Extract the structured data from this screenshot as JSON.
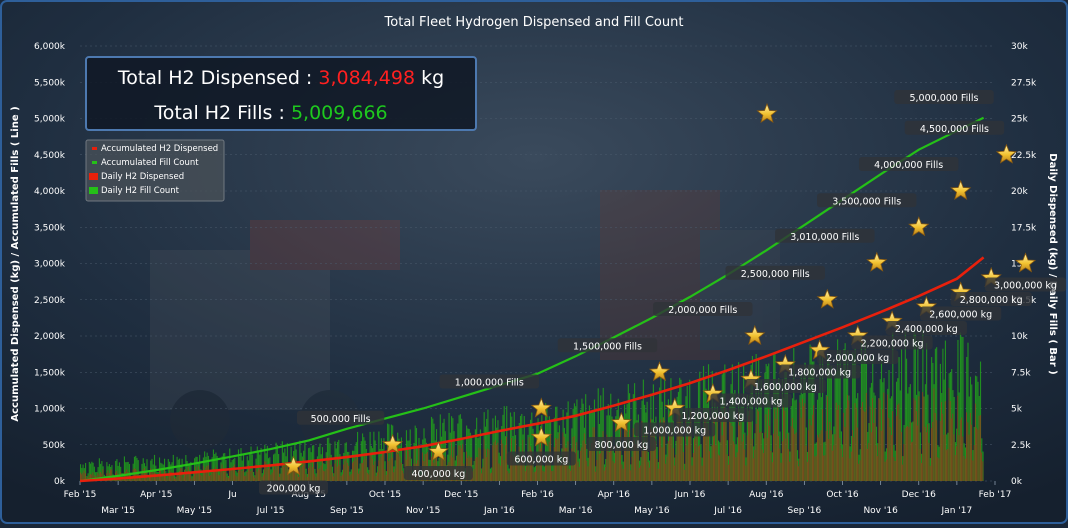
{
  "chart_data": {
    "type": "line+bar",
    "title": "Total Fleet Hydrogen Dispensed and Fill Count",
    "ylabel_left": "Accumulated Dispensed (kg) / Accumulated Fills ( Line )",
    "ylabel_right": "Daily Dispensed (kg) / Daily Fills ( Bar )",
    "ylim_left": [
      0,
      6000
    ],
    "ylim_right": [
      0,
      30000
    ],
    "y_ticks_left": [
      "0k",
      "500k",
      "1,000k",
      "1,500k",
      "2,000k",
      "2,500k",
      "3,000k",
      "3,500k",
      "4,000k",
      "4,500k",
      "5,000k",
      "5,500k",
      "6,000k"
    ],
    "y_ticks_right": [
      "0k",
      "2.5k",
      "5k",
      "7.5k",
      "10k",
      "12.5k",
      "15k",
      "17.5k",
      "20k",
      "22.5k",
      "25k",
      "27.5k",
      "30k"
    ],
    "x_ticks": [
      "Feb '15",
      "Mar '15",
      "Apr '15",
      "May '15",
      "Jun '15",
      "Jul '15",
      "Aug '15",
      "Sep '15",
      "Oct '15",
      "Nov '15",
      "Dec '15",
      "Jan '16",
      "Feb '16",
      "Mar '16",
      "Apr '16",
      "May '16",
      "Jun '16",
      "Jul '16",
      "Aug '16",
      "Sep '16",
      "Oct '16",
      "Nov '16",
      "Dec '16",
      "Jan '17",
      "Feb '17"
    ],
    "x_ticks_display": [
      "Feb '15",
      "Mar '15",
      "Apr '15",
      "May '15",
      "Ju",
      "Jul '15",
      "Aug '15",
      "Sep '15",
      "Oct '15",
      "Nov '15",
      "Dec '15",
      "Jan '16",
      "Feb '16",
      "Mar '16",
      "Apr '16",
      "May '16",
      "Jun '16",
      "Jul '16",
      "Aug '16",
      "Sep '16",
      "Oct '16",
      "Nov '16",
      "Dec '16",
      "Jan '17",
      "Feb '17"
    ],
    "legend": [
      "Accumulated H2 Dispensed",
      "Accumulated Fill Count",
      "Daily H2 Dispensed",
      "Daily H2 Fill Count"
    ],
    "legend_position": "top-left",
    "series_colors": {
      "dispensed": "#e8200c",
      "fills": "#25c018"
    },
    "accumulated_dispensed": {
      "x": [
        0,
        1,
        2,
        3,
        4,
        5,
        6,
        7,
        8,
        9,
        10,
        11,
        12,
        13,
        14,
        15,
        16,
        17,
        18,
        19,
        20,
        21,
        22,
        23,
        23.7
      ],
      "y": [
        0,
        35,
        75,
        120,
        165,
        215,
        270,
        330,
        400,
        480,
        580,
        690,
        790,
        900,
        1040,
        1190,
        1350,
        1530,
        1720,
        1920,
        2120,
        2330,
        2550,
        2790,
        3084
      ]
    },
    "accumulated_fills": {
      "x": [
        0,
        1,
        2,
        3,
        4,
        5,
        6,
        7,
        8,
        9,
        10,
        11,
        12,
        13,
        14,
        15,
        16,
        17,
        18,
        19,
        20,
        21,
        22,
        23,
        23.7
      ],
      "y": [
        0,
        70,
        150,
        240,
        340,
        440,
        560,
        720,
        860,
        1000,
        1160,
        1320,
        1480,
        1720,
        1980,
        2250,
        2540,
        2850,
        3180,
        3530,
        3880,
        4230,
        4570,
        4830,
        5010
      ]
    },
    "daily_fill_upper": {
      "x": [
        0,
        1,
        2,
        3,
        4,
        5,
        6,
        7,
        8,
        9,
        10,
        11,
        12,
        13,
        14,
        15,
        16,
        17,
        18,
        19,
        20,
        21,
        22,
        23,
        23.7
      ],
      "y": [
        1500,
        1700,
        1900,
        2100,
        2300,
        2700,
        3000,
        3400,
        4000,
        4400,
        5000,
        5200,
        5300,
        6000,
        6800,
        7200,
        7800,
        8400,
        9000,
        9400,
        10000,
        10200,
        10600,
        10400,
        9600
      ]
    },
    "daily_dispensed_upper": {
      "x": [
        0,
        1,
        2,
        3,
        4,
        5,
        6,
        7,
        8,
        9,
        10,
        11,
        12,
        13,
        14,
        15,
        16,
        17,
        18,
        19,
        20,
        21,
        22,
        23,
        23.7
      ],
      "y": [
        800,
        900,
        1000,
        1100,
        1250,
        1500,
        1700,
        2000,
        2400,
        2700,
        3000,
        3200,
        3400,
        3800,
        4300,
        4700,
        5100,
        5500,
        5900,
        6200,
        6500,
        6700,
        7000,
        6900,
        6400
      ]
    },
    "milestones_dispensed": [
      {
        "x": 5.6,
        "y": 200,
        "label": "200,000 kg"
      },
      {
        "x": 9.4,
        "y": 400,
        "label": "400,000 kg"
      },
      {
        "x": 12.1,
        "y": 600,
        "label": "600,000 kg"
      },
      {
        "x": 14.2,
        "y": 800,
        "label": "800,000 kg"
      },
      {
        "x": 15.6,
        "y": 1000,
        "label": "1,000,000 kg"
      },
      {
        "x": 16.6,
        "y": 1200,
        "label": "1,200,000 kg"
      },
      {
        "x": 17.6,
        "y": 1400,
        "label": "1,400,000 kg"
      },
      {
        "x": 18.5,
        "y": 1600,
        "label": "1,600,000 kg"
      },
      {
        "x": 19.4,
        "y": 1800,
        "label": "1,800,000 kg"
      },
      {
        "x": 20.4,
        "y": 2000,
        "label": "2,000,000 kg"
      },
      {
        "x": 21.3,
        "y": 2200,
        "label": "2,200,000 kg"
      },
      {
        "x": 22.2,
        "y": 2400,
        "label": "2,400,000 kg"
      },
      {
        "x": 23.1,
        "y": 2600,
        "label": "2,600,000 kg"
      },
      {
        "x": 23.9,
        "y": 2800,
        "label": "2,800,000 kg"
      },
      {
        "x": 24.8,
        "y": 3000,
        "label": "3,000,000 kg"
      }
    ],
    "milestones_fills": [
      {
        "x": 8.2,
        "y": 500,
        "label": "500,000 Fills"
      },
      {
        "x": 12.1,
        "y": 1000,
        "label": "1,000,000 Fills"
      },
      {
        "x": 15.2,
        "y": 1500,
        "label": "1,500,000 Fills"
      },
      {
        "x": 17.7,
        "y": 2000,
        "label": "2,000,000 Fills"
      },
      {
        "x": 19.6,
        "y": 2500,
        "label": "2,500,000 Fills"
      },
      {
        "x": 20.9,
        "y": 3010,
        "label": "3,010,000 Fills"
      },
      {
        "x": 22.0,
        "y": 3500,
        "label": "3,500,000 Fills"
      },
      {
        "x": 23.1,
        "y": 4000,
        "label": "4,000,000 Fills"
      },
      {
        "x": 24.3,
        "y": 4500,
        "label": "4,500,000 Fills"
      },
      {
        "x": 25.8,
        "y": 5000,
        "label": "5,000,000 Fills"
      }
    ]
  },
  "summary": {
    "dispensed_label": "Total H2 Dispensed : ",
    "dispensed_value": "3,084,498",
    "dispensed_unit": " kg",
    "fills_label": "Total H2 Fills : ",
    "fills_value": "5,009,666",
    "dispensed_color": "#ff2020",
    "fills_color": "#1ec81e"
  }
}
